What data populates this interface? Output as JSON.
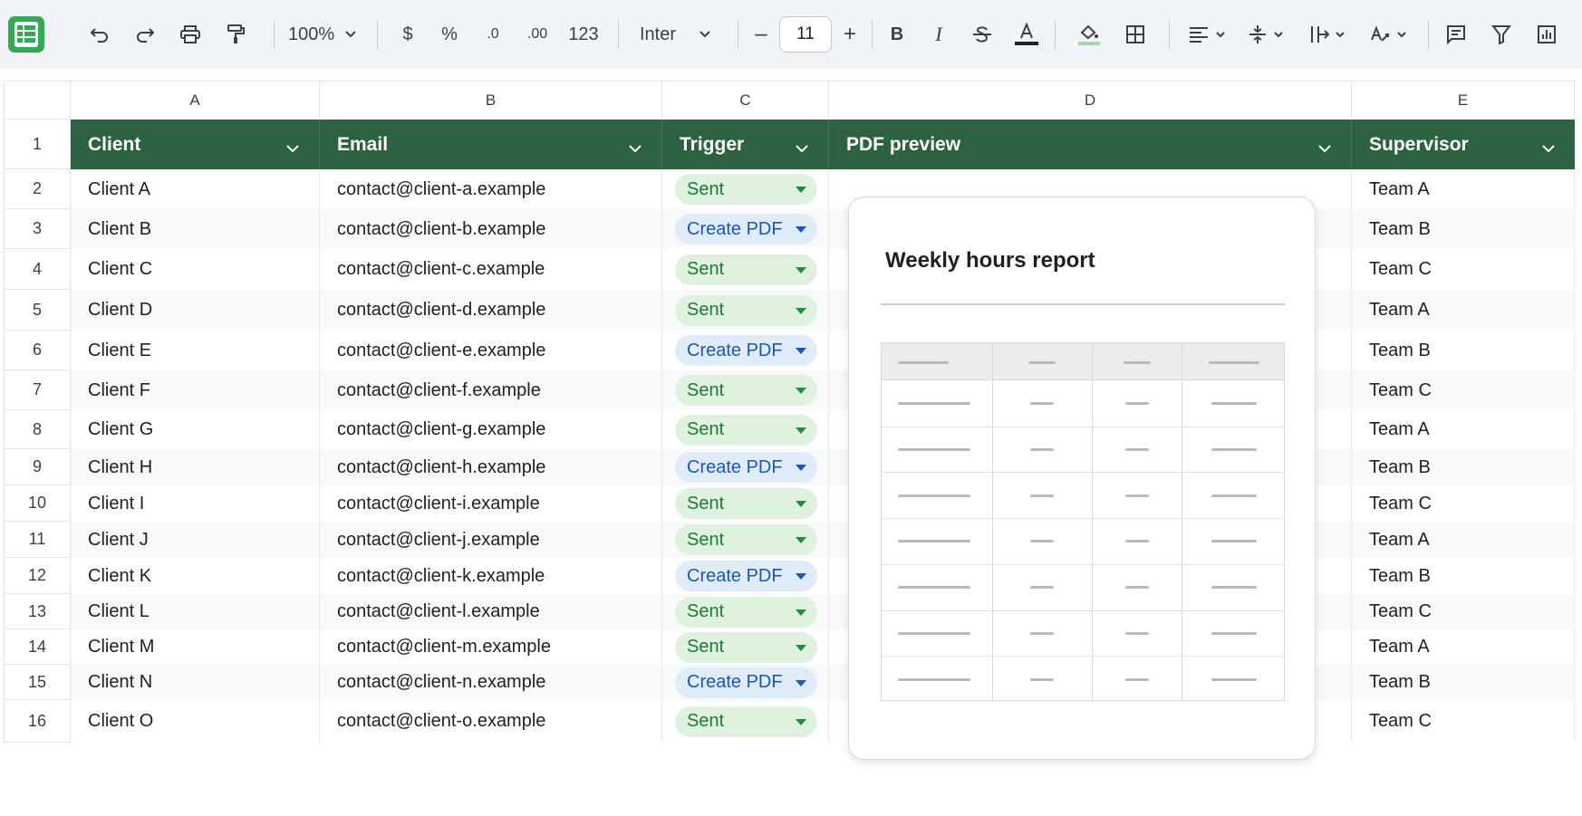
{
  "toolbar": {
    "zoom": "100%",
    "currency": "$",
    "percent": "%",
    "decrease_decimals": ".0",
    "increase_decimals": ".00",
    "number_format": "123",
    "font_name": "Inter",
    "font_size": "11",
    "minus": "–",
    "plus": "+",
    "bold": "B",
    "italic": "I"
  },
  "columns": [
    "A",
    "B",
    "C",
    "D",
    "E"
  ],
  "headers": {
    "client": "Client",
    "email": "Email",
    "trigger": "Trigger",
    "pdf_preview": "PDF preview",
    "supervisor": "Supervisor"
  },
  "row_numbers": [
    "1",
    "2",
    "3",
    "4",
    "5",
    "6",
    "7",
    "8",
    "9",
    "10",
    "11",
    "12",
    "13",
    "14",
    "15",
    "16"
  ],
  "rows": [
    {
      "client": "Client A",
      "email": "contact@client-a.example",
      "trigger": "Sent",
      "supervisor": "Team A"
    },
    {
      "client": "Client B",
      "email": "contact@client-b.example",
      "trigger": "Create PDF",
      "supervisor": "Team B"
    },
    {
      "client": "Client C",
      "email": "contact@client-c.example",
      "trigger": "Sent",
      "supervisor": "Team C"
    },
    {
      "client": "Client D",
      "email": "contact@client-d.example",
      "trigger": "Sent",
      "supervisor": "Team A"
    },
    {
      "client": "Client E",
      "email": "contact@client-e.example",
      "trigger": "Create PDF",
      "supervisor": "Team B"
    },
    {
      "client": "Client F",
      "email": "contact@client-f.example",
      "trigger": "Sent",
      "supervisor": "Team C"
    },
    {
      "client": "Client G",
      "email": "contact@client-g.example",
      "trigger": "Sent",
      "supervisor": "Team A"
    },
    {
      "client": "Client H",
      "email": "contact@client-h.example",
      "trigger": "Create PDF",
      "supervisor": "Team B"
    },
    {
      "client": "Client I",
      "email": "contact@client-i.example",
      "trigger": "Sent",
      "supervisor": "Team C"
    },
    {
      "client": "Client J",
      "email": "contact@client-j.example",
      "trigger": "Sent",
      "supervisor": "Team A"
    },
    {
      "client": "Client K",
      "email": "contact@client-k.example",
      "trigger": "Create PDF",
      "supervisor": "Team B"
    },
    {
      "client": "Client L",
      "email": "contact@client-l.example",
      "trigger": "Sent",
      "supervisor": "Team C"
    },
    {
      "client": "Client M",
      "email": "contact@client-m.example",
      "trigger": "Sent",
      "supervisor": "Team A"
    },
    {
      "client": "Client N",
      "email": "contact@client-n.example",
      "trigger": "Create PDF",
      "supervisor": "Team B"
    },
    {
      "client": "Client O",
      "email": "contact@client-o.example",
      "trigger": "Sent",
      "supervisor": "Team C"
    }
  ],
  "pdf_preview": {
    "title": "Weekly hours report"
  },
  "colors": {
    "header_green": "#2d6241",
    "sent_bg": "#dff1df",
    "sent_text": "#1e7a34",
    "create_bg": "#e1ecfb",
    "create_text": "#1a56b8",
    "toolbar_bg": "#f0f4f9"
  }
}
